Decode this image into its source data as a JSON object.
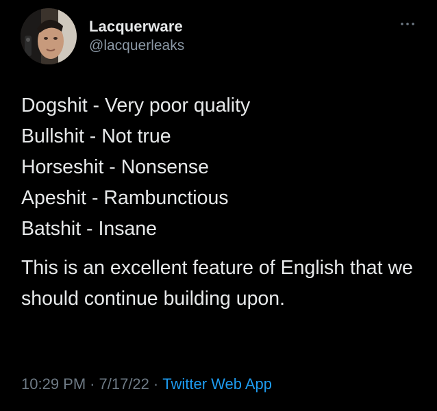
{
  "tweet": {
    "author": {
      "display_name": "Lacquerware",
      "handle": "@lacquerleaks",
      "avatar": "profile-photo"
    },
    "more_icon": "more-horizontal-icon",
    "lines": [
      "Dogshit - Very poor quality",
      "Bullshit - Not true",
      "Horseshit - Nonsense",
      "Apeshit - Rambunctious",
      "Batshit - Insane"
    ],
    "paragraph": "This is an excellent feature of English that we should continue building upon.",
    "time": "10:29 PM",
    "separator": "·",
    "date": "7/17/22",
    "source": "Twitter Web App"
  },
  "colors": {
    "background": "#000000",
    "text": "#e7e9ea",
    "secondary": "#8b98a5",
    "meta": "#6e7a85",
    "link": "#1d9bf0"
  }
}
